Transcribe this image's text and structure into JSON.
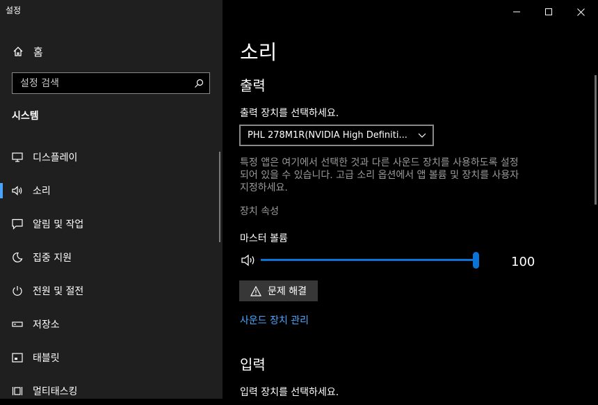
{
  "app": {
    "title": "설정"
  },
  "sidebar": {
    "home_label": "홈",
    "search_placeholder": "설정 검색",
    "section_title": "시스템",
    "items": [
      {
        "label": "디스플레이",
        "icon": "monitor-icon"
      },
      {
        "label": "소리",
        "icon": "speaker-icon",
        "active": true
      },
      {
        "label": "알림 및 작업",
        "icon": "notification-icon"
      },
      {
        "label": "집중 지원",
        "icon": "moon-icon"
      },
      {
        "label": "전원 및 절전",
        "icon": "power-icon"
      },
      {
        "label": "저장소",
        "icon": "storage-icon"
      },
      {
        "label": "태블릿",
        "icon": "tablet-icon"
      },
      {
        "label": "멀티태스킹",
        "icon": "multitasking-icon"
      }
    ]
  },
  "main": {
    "title": "소리",
    "output": {
      "heading": "출력",
      "choose_label": "출력 장치를 선택하세요.",
      "selected_device": "PHL 278M1R(NVIDIA High Definiti...",
      "description_lines": [
        "특정 앱은 여기에서 선택한 것과 다른 사운드 장치를 사용하도록 설정",
        "되어 있을 수 있습니다. 고급 소리 옵션에서 앱 볼륨 및 장치를 사용자",
        "지정하세요."
      ],
      "device_properties": "장치 속성",
      "master_volume_label": "마스터 볼륨",
      "volume_value": "100",
      "troubleshoot_label": "문제 해결",
      "manage_devices_link": "사운드 장치 관리"
    },
    "input": {
      "heading": "입력",
      "choose_label": "입력 장치를 선택하세요."
    }
  },
  "colors": {
    "accent": "#0a74d6",
    "link": "#4aa8ff",
    "sidebar_bg": "#1f1f1f",
    "main_bg": "#000000"
  }
}
